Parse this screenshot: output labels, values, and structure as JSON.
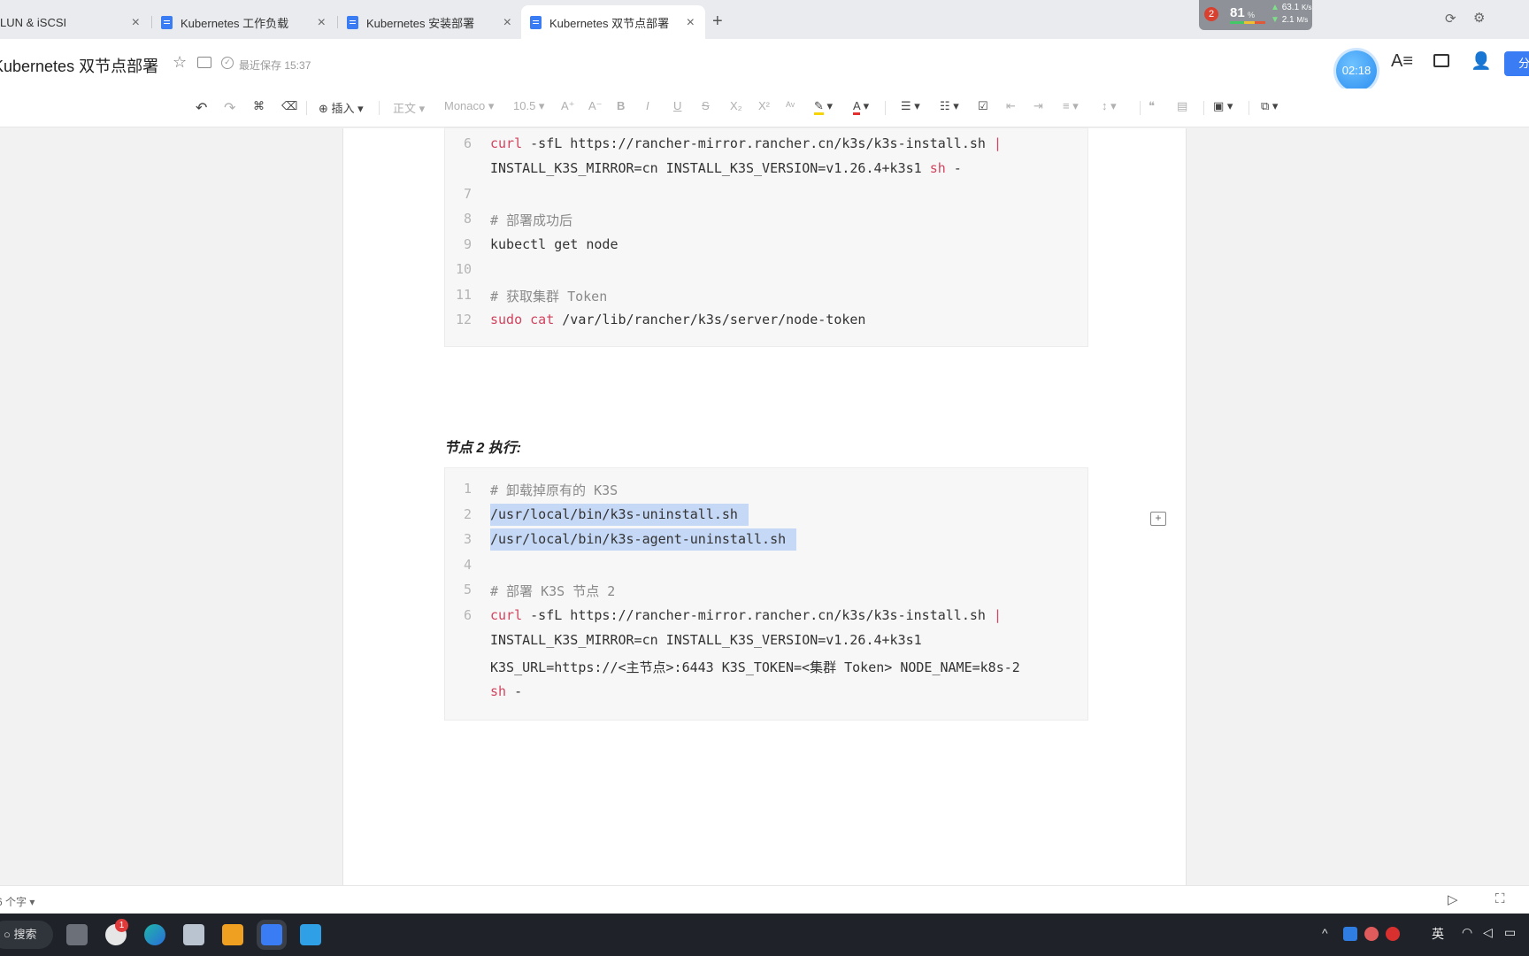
{
  "tabs": [
    {
      "label": "LUN & iSCSI"
    },
    {
      "label": "Kubernetes 工作负载"
    },
    {
      "label": "Kubernetes 安装部署"
    },
    {
      "label": "Kubernetes 双节点部署"
    }
  ],
  "tray_widget": {
    "badge": "2",
    "cpu": "81",
    "cpu_unit": "%",
    "up": "63.1",
    "up_unit": "K/s",
    "down": "2.1",
    "down_unit": "M/s"
  },
  "header": {
    "doc_title": "Kubernetes 双节点部署",
    "save_status": "最近保存 15:37",
    "timer": "02:18",
    "share_label": "分"
  },
  "toolbar": {
    "insert": "插入",
    "style": "正文",
    "font": "Monaco",
    "size": "10.5"
  },
  "section_heading": "节点 2 执行:",
  "code_block_1": [
    {
      "no": "6",
      "text": "curl -sfL https://rancher-mirror.rancher.cn/k3s/k3s-install.sh |"
    },
    {
      "no": "",
      "text": "INSTALL_K3S_MIRROR=cn INSTALL_K3S_VERSION=v1.26.4+k3s1 sh -"
    },
    {
      "no": "7",
      "text": ""
    },
    {
      "no": "8",
      "text": "# 部署成功后"
    },
    {
      "no": "9",
      "text": "kubectl get node"
    },
    {
      "no": "10",
      "text": ""
    },
    {
      "no": "11",
      "text": "# 获取集群 Token"
    },
    {
      "no": "12",
      "text": "sudo cat /var/lib/rancher/k3s/server/node-token"
    }
  ],
  "code_block_2": [
    {
      "no": "1",
      "text": "# 卸载掉原有的 K3S"
    },
    {
      "no": "2",
      "text": "/usr/local/bin/k3s-uninstall.sh"
    },
    {
      "no": "3",
      "text": "/usr/local/bin/k3s-agent-uninstall.sh"
    },
    {
      "no": "4",
      "text": ""
    },
    {
      "no": "5",
      "text": "# 部署 K3S 节点 2"
    },
    {
      "no": "6",
      "text": "curl -sfL https://rancher-mirror.rancher.cn/k3s/k3s-install.sh |"
    },
    {
      "no": "",
      "text": "INSTALL_K3S_MIRROR=cn INSTALL_K3S_VERSION=v1.26.4+k3s1"
    },
    {
      "no": "",
      "text": "K3S_URL=https://<主节点>:6443 K3S_TOKEN=<集群 Token> NODE_NAME=k8s-2"
    },
    {
      "no": "",
      "text": "sh -"
    }
  ],
  "statusbar": {
    "word_count": "6 个字"
  },
  "taskbar": {
    "search": "搜索",
    "weather_badge": "1",
    "ime": "英"
  },
  "colors": {
    "accent": "#3a7cf3",
    "keyword": "#d0455f",
    "selection": "#c5d8f6",
    "taskbar": "#1f2329"
  }
}
